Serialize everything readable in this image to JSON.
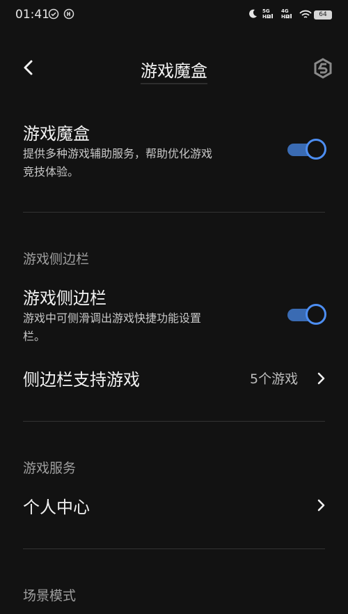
{
  "status_bar": {
    "time": "01:41",
    "net1": "5G HD",
    "net2": "4G HD",
    "battery": "64"
  },
  "header": {
    "title": "游戏魔盒"
  },
  "game_box": {
    "title": "游戏魔盒",
    "description_line1": "提供多种游戏辅助服务，帮助优化游戏",
    "description_line2": "竞技体验。",
    "enabled": true
  },
  "sidebar_section": {
    "header": "游戏侧边栏",
    "item_title": "游戏侧边栏",
    "item_desc_line1": "游戏中可侧滑调出游戏快捷功能设置",
    "item_desc_line2": "栏。",
    "enabled": true,
    "supported_label": "侧边栏支持游戏",
    "supported_value": "5个游戏"
  },
  "services_section": {
    "header": "游戏服务",
    "personal_center": "个人中心"
  },
  "scene_section": {
    "header": "场景模式"
  },
  "colors": {
    "background": "#121212",
    "accent": "#4d8ef2"
  }
}
